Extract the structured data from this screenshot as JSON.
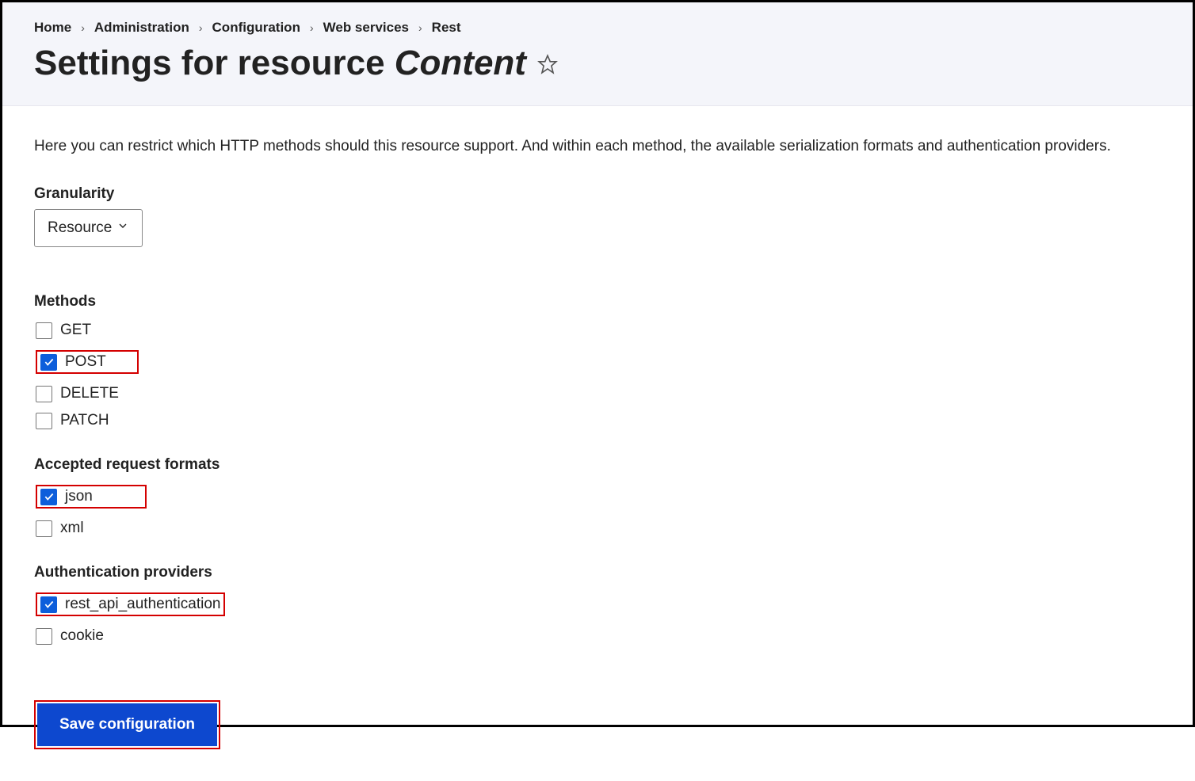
{
  "breadcrumb": [
    "Home",
    "Administration",
    "Configuration",
    "Web services",
    "Rest"
  ],
  "title_prefix": "Settings for resource ",
  "title_resource": "Content",
  "intro": "Here you can restrict which HTTP methods should this resource support. And within each method, the available serialization formats and authentication providers.",
  "granularity": {
    "label": "Granularity",
    "value": "Resource"
  },
  "methods": {
    "label": "Methods",
    "items": [
      {
        "label": "GET",
        "checked": false,
        "highlight": false
      },
      {
        "label": "POST",
        "checked": true,
        "highlight": true
      },
      {
        "label": "DELETE",
        "checked": false,
        "highlight": false
      },
      {
        "label": "PATCH",
        "checked": false,
        "highlight": false
      }
    ]
  },
  "formats": {
    "label": "Accepted request formats",
    "items": [
      {
        "label": "json",
        "checked": true,
        "highlight": true
      },
      {
        "label": "xml",
        "checked": false,
        "highlight": false
      }
    ]
  },
  "auth": {
    "label": "Authentication providers",
    "items": [
      {
        "label": "rest_api_authentication",
        "checked": true,
        "highlight": true
      },
      {
        "label": "cookie",
        "checked": false,
        "highlight": false
      }
    ]
  },
  "save_label": "Save configuration"
}
